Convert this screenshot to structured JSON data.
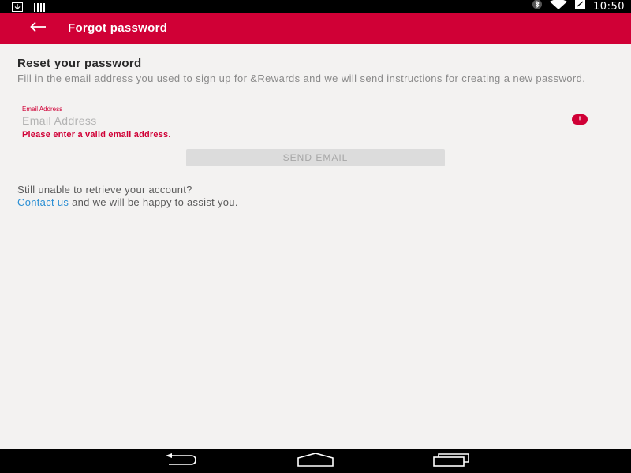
{
  "status_bar": {
    "time": "10:50",
    "icons": [
      "download-icon",
      "bars-icon",
      "bluetooth-icon",
      "wifi-icon",
      "battery-icon"
    ]
  },
  "app_bar": {
    "title": "Forgot password",
    "back_icon": "arrow-left-icon",
    "background": "#d00036"
  },
  "main": {
    "heading": "Reset your password",
    "description": "Fill in the email address you used to sign up for &Rewards and we will send instructions for creating a new password.",
    "email_field": {
      "label": "Email Address",
      "placeholder": "Email Address",
      "value": "",
      "error_icon": "error-icon",
      "error_text": "Please enter a valid email address."
    },
    "send_button_label": "SEND EMAIL",
    "help": {
      "line1": "Still unable to retrieve your account?",
      "link_text": "Contact us",
      "line2_rest": " and we will be happy to assist you."
    }
  },
  "nav_bar": {
    "buttons": [
      "back-nav-icon",
      "home-nav-icon",
      "recents-nav-icon"
    ]
  },
  "colors": {
    "accent": "#d00036",
    "link": "#2a8fd4",
    "background": "#f3f2f1"
  }
}
